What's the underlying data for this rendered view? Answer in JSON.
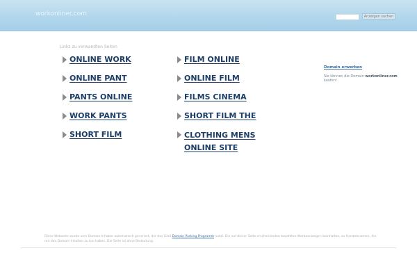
{
  "header": {
    "site_name": "workonliner.com",
    "search_value": "",
    "search_button": "Anzeigen suchen"
  },
  "main": {
    "related_heading": "Links zu verwandten Seiten",
    "left_links": [
      {
        "label": "ONLINE WORK"
      },
      {
        "label": "ONLINE PANT"
      },
      {
        "label": "PANTS ONLINE"
      },
      {
        "label": "WORK PANTS"
      },
      {
        "label": "SHORT FILM"
      }
    ],
    "right_links": [
      {
        "label": "FILM ONLINE"
      },
      {
        "label": "ONLINE FILM"
      },
      {
        "label": "FILMS CINEMA"
      },
      {
        "label": "SHORT FILM THE"
      },
      {
        "label": "CLOTHING MENS ONLINE SITE"
      }
    ]
  },
  "sidebar": {
    "title": "Domain erwerben",
    "text_before": "Sie können die Domain ",
    "domain": "workonliner.com",
    "text_after": " kaufen!"
  },
  "footer": {
    "text_before": "Diese Webseite wurde vom Domain-Inhaber automatisch generiert, der das Geld ",
    "link": "Domain Parking Programm",
    "text_after": " nutzt. Die auf dieser Seite erscheinenden bezahlten Werbeanzeigen beinhalten, zu Handelsnamen, die mit den Domain Inhalten zu tun haben. Die Seite ist ohne Bedeutung."
  },
  "colors": {
    "banner": "#b0d6ec",
    "link": "#1c3e67",
    "arrow": "#8a8a8a"
  }
}
